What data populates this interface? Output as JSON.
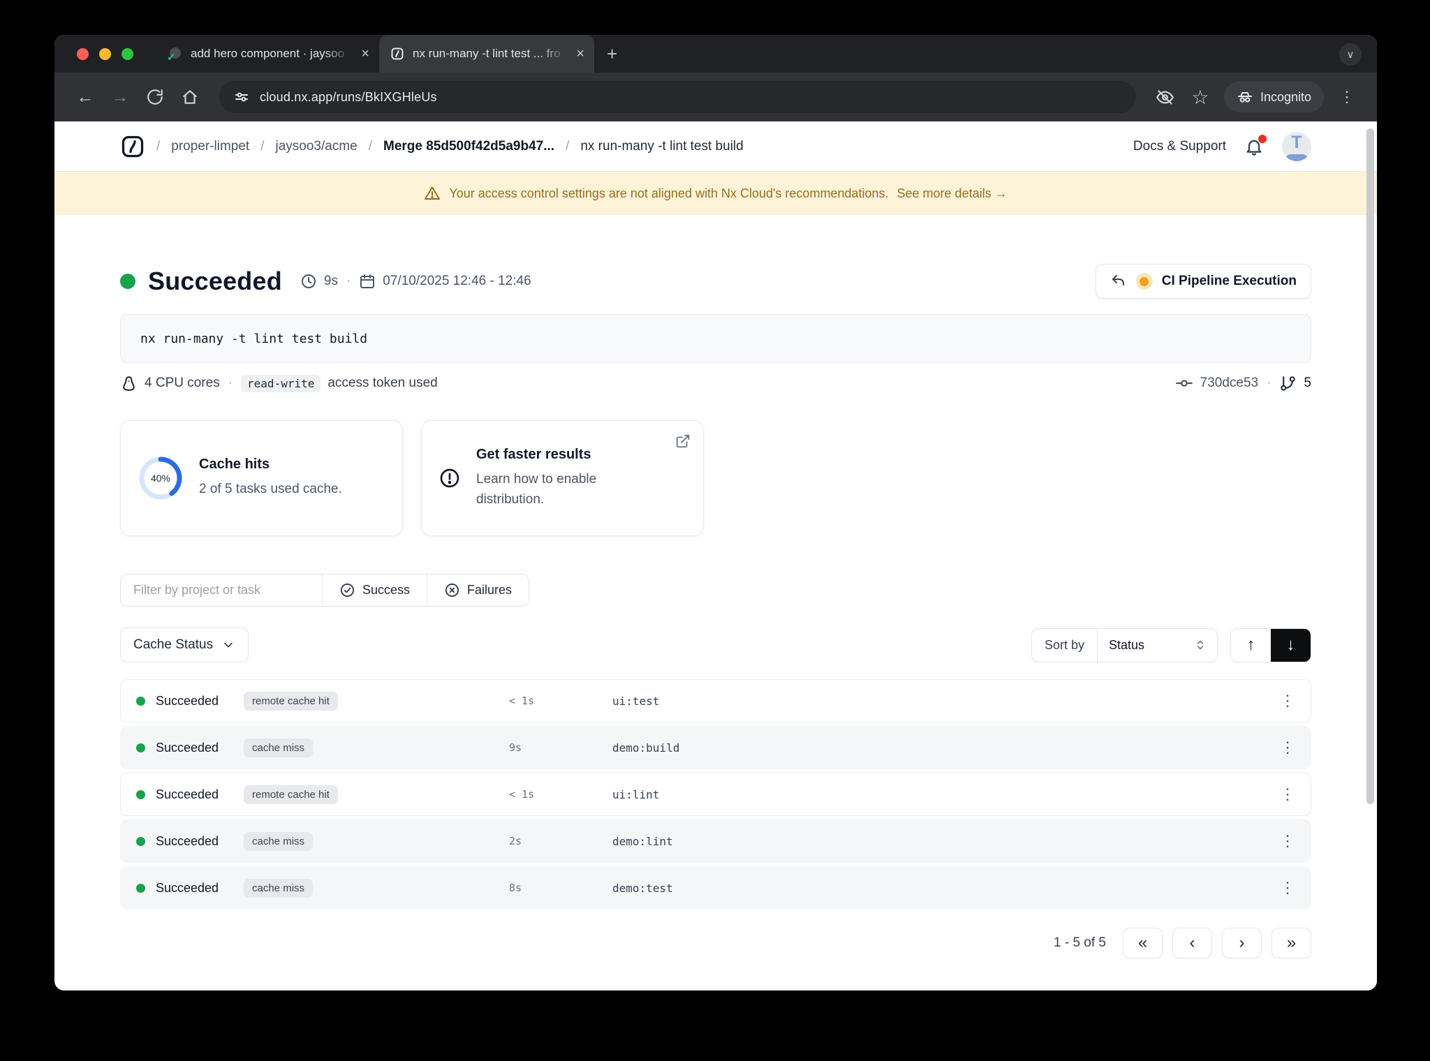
{
  "browser": {
    "tabs": [
      {
        "title": "add hero component · jaysoo",
        "close": "×"
      },
      {
        "title": "nx run-many -t lint test ... fro",
        "close": "×"
      }
    ],
    "new_tab": "+",
    "tab_search": "∨",
    "back": "←",
    "forward": "→",
    "url": "cloud.nx.app/runs/BkIXGHleUs",
    "incognito": "Incognito",
    "star": "☆",
    "menu": "⋮"
  },
  "header": {
    "separator": "/",
    "crumbs": {
      "workspace": "proper-limpet",
      "repo": "jaysoo3/acme",
      "merge": "Merge 85d500f42d5a9b47...",
      "run": "nx run-many -t lint test build"
    },
    "docs": "Docs & Support",
    "avatar": "T"
  },
  "banner": {
    "message": "Your access control settings are not aligned with Nx Cloud's recommendations.",
    "link": "See more details →"
  },
  "run": {
    "status": "Succeeded",
    "duration": "9s",
    "dot_sep": "·",
    "dates": "07/10/2025 12:46 - 12:46",
    "pipeline": "CI Pipeline Execution",
    "command": "nx run-many -t lint test build",
    "cpu": "4 CPU cores",
    "token": "read-write",
    "token_text": "access token used",
    "commit": "730dce53",
    "branches": "5"
  },
  "cards": {
    "cache": {
      "percent": 40,
      "percent_label": "40%",
      "title": "Cache hits",
      "subtitle": "2 of 5 tasks used cache."
    },
    "dte": {
      "title": "Get faster results",
      "body": "Learn how to enable distribution."
    }
  },
  "filters": {
    "placeholder": "Filter by project or task",
    "success": "Success",
    "failures": "Failures"
  },
  "controls": {
    "cache_status": "Cache Status",
    "sort_by": "Sort by",
    "sort_value": "Status",
    "asc": "↑",
    "desc": "↓"
  },
  "table": {
    "kebab": "⋮",
    "rows": [
      {
        "status": "Succeeded",
        "badge": "remote cache hit",
        "duration": "< 1s",
        "task": "ui:test"
      },
      {
        "status": "Succeeded",
        "badge": "cache miss",
        "duration": "9s",
        "task": "demo:build"
      },
      {
        "status": "Succeeded",
        "badge": "remote cache hit",
        "duration": "< 1s",
        "task": "ui:lint"
      },
      {
        "status": "Succeeded",
        "badge": "cache miss",
        "duration": "2s",
        "task": "demo:lint"
      },
      {
        "status": "Succeeded",
        "badge": "cache miss",
        "duration": "8s",
        "task": "demo:test"
      }
    ]
  },
  "pagination": {
    "label": "1 - 5 of 5",
    "first": "«",
    "prev": "‹",
    "next": "›",
    "last": "»"
  },
  "colors": {
    "accent_blue": "#2d6ce0",
    "success_green": "#16a34a",
    "warning_amber": "#9a6d1a",
    "pipeline_dot": "#f0a11f"
  }
}
